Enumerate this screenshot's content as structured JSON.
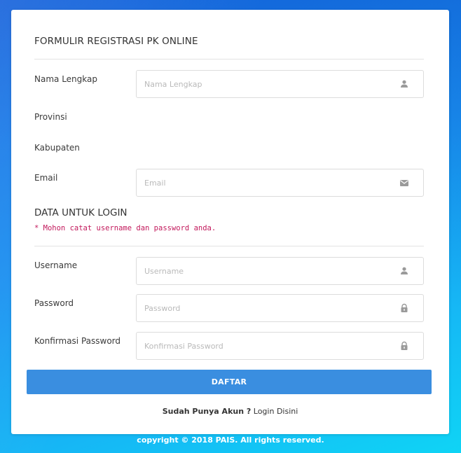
{
  "form": {
    "title": "FORMULIR REGISTRASI PK ONLINE",
    "fields": {
      "nama": {
        "label": "Nama Lengkap",
        "placeholder": "Nama Lengkap"
      },
      "provinsi": {
        "label": "Provinsi"
      },
      "kabupaten": {
        "label": "Kabupaten"
      },
      "email": {
        "label": "Email",
        "placeholder": "Email"
      }
    }
  },
  "login_section": {
    "title": "DATA UNTUK LOGIN",
    "notice": "* Mohon catat username dan password anda.",
    "fields": {
      "username": {
        "label": "Username",
        "placeholder": "Username"
      },
      "password": {
        "label": "Password",
        "placeholder": "Password"
      },
      "konfirmasi": {
        "label": "Konfirmasi Password",
        "placeholder": "Konfirmasi Password"
      }
    }
  },
  "actions": {
    "submit_label": "DAFTAR",
    "have_account": "Sudah Punya Akun ?",
    "login_link": "Login Disini"
  },
  "footer": {
    "copyright": "copyright © 2018 PAIS. All rights reserved."
  },
  "icons": {
    "nama": "user-icon",
    "email": "envelope-icon",
    "username": "user-icon",
    "password": "lock-icon",
    "konfirmasi": "lock-icon"
  },
  "colors": {
    "primary_button": "#3a8ee0",
    "notice": "#c2185b",
    "background_top": "#1565e0",
    "background_bottom": "#0fd4f5"
  }
}
